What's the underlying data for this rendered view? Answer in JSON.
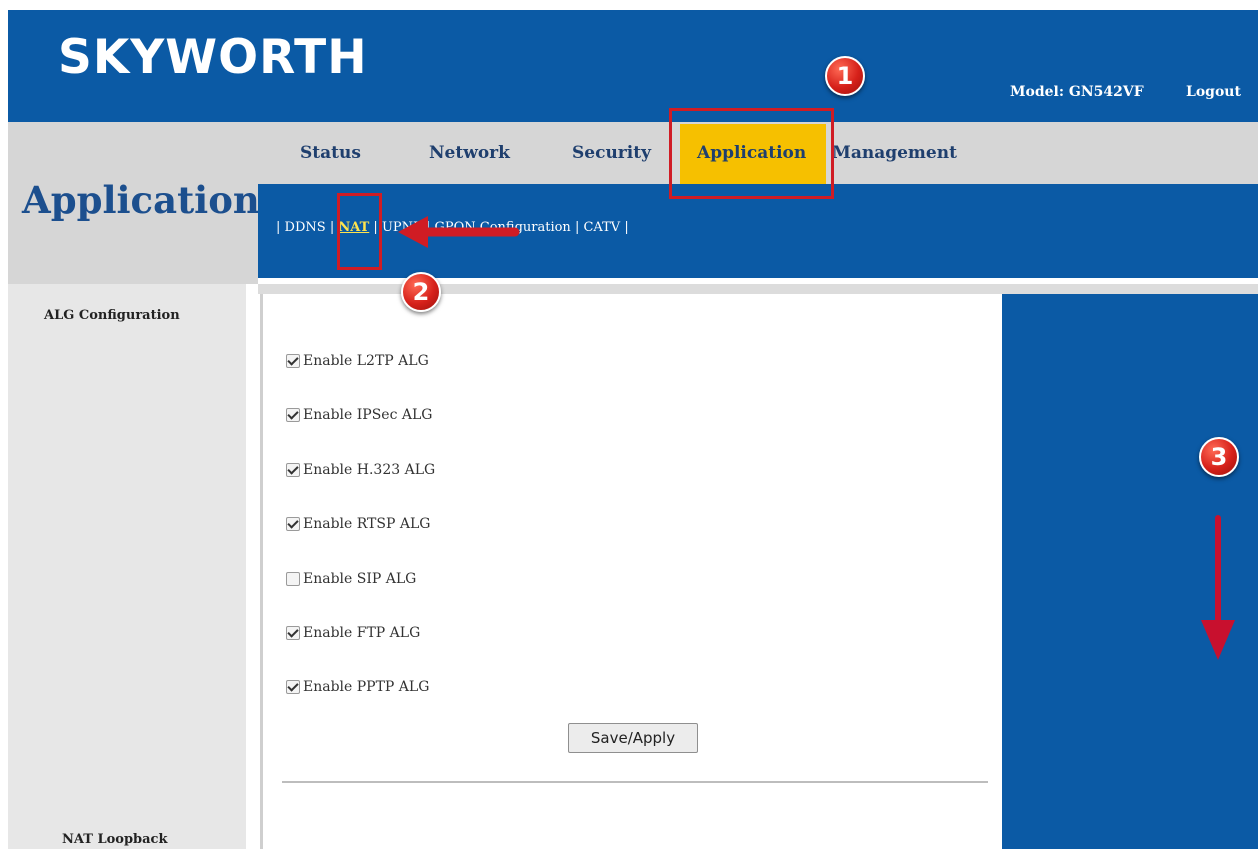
{
  "header": {
    "brand": "SKYWORTH",
    "model": "Model: GN542VF",
    "logout": "Logout"
  },
  "page_title": "Application",
  "nav": {
    "tabs": [
      {
        "label": "Status"
      },
      {
        "label": "Network"
      },
      {
        "label": "Security"
      },
      {
        "label": "Application",
        "active": true
      },
      {
        "label": "Management"
      }
    ]
  },
  "submenu": {
    "items": [
      {
        "label": "DDNS"
      },
      {
        "label": "NAT",
        "active": true
      },
      {
        "label": "UPNP"
      },
      {
        "label": "GPON Configuration"
      },
      {
        "label": "CATV"
      }
    ]
  },
  "sidebar": {
    "alg_label": "ALG Configuration",
    "nat_loopback_label": "NAT Loopback"
  },
  "alg_options": [
    {
      "label": "Enable L2TP ALG",
      "checked": true
    },
    {
      "label": "Enable IPSec ALG",
      "checked": true
    },
    {
      "label": "Enable H.323 ALG",
      "checked": true
    },
    {
      "label": "Enable RTSP ALG",
      "checked": true
    },
    {
      "label": "Enable SIP ALG",
      "checked": false
    },
    {
      "label": "Enable FTP ALG",
      "checked": true
    },
    {
      "label": "Enable PPTP ALG",
      "checked": true
    }
  ],
  "save_button": "Save/Apply",
  "annotations": {
    "badge1": "1",
    "badge2": "2",
    "badge3": "3"
  },
  "colors": {
    "header_blue": "#0b5aa5",
    "active_tab": "#f6c000",
    "annotation_red": "#d01c24"
  }
}
